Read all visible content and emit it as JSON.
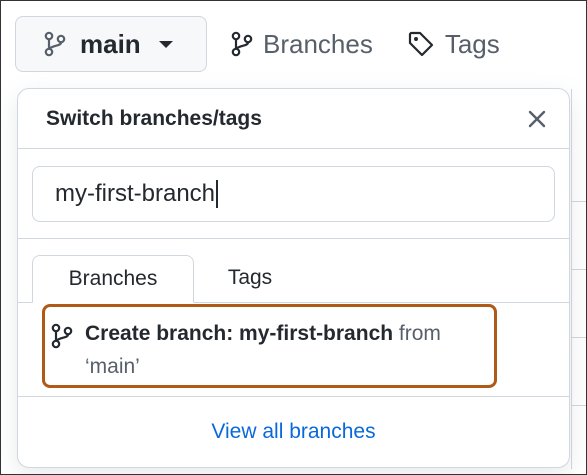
{
  "topbar": {
    "branch_button": {
      "label": "main",
      "icon": "git-branch-icon"
    },
    "branches_link": {
      "label": "Branches",
      "icon": "git-branch-icon"
    },
    "tags_link": {
      "label": "Tags",
      "icon": "tag-icon"
    }
  },
  "dropdown": {
    "title": "Switch branches/tags",
    "close_icon": "close-icon",
    "filter": {
      "value": "my-first-branch",
      "placeholder": ""
    },
    "tabs": [
      {
        "label": "Branches",
        "active": true
      },
      {
        "label": "Tags",
        "active": false
      }
    ],
    "create_item": {
      "prefix": "Create branch: ",
      "branch_name": "my-first-branch",
      "from_text": "from",
      "source": "‘main’",
      "icon": "git-branch-icon"
    },
    "footer_link": "View all branches"
  },
  "colors": {
    "accent_link": "#0969da",
    "highlight_border": "#b05a1a",
    "border": "#d0d7de"
  }
}
